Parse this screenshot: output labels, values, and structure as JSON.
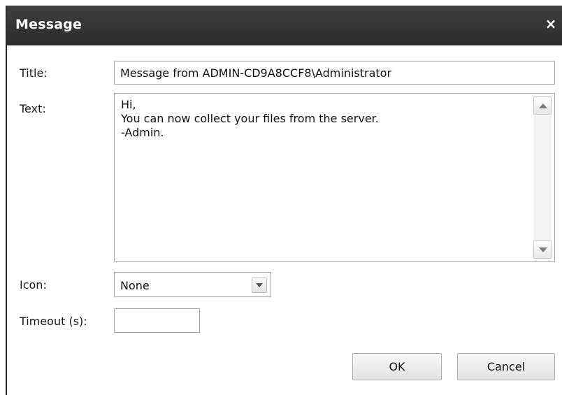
{
  "dialog": {
    "title": "Message",
    "close_glyph": "×"
  },
  "form": {
    "title_label": "Title:",
    "title_value": "Message from ADMIN-CD9A8CCF8\\Administrator",
    "text_label": "Text:",
    "text_lines": [
      "Hi,",
      "You can now collect your files from the server.",
      "-Admin."
    ],
    "icon_label": "Icon:",
    "icon_value": "None",
    "timeout_label": "Timeout (s):",
    "timeout_value": ""
  },
  "buttons": {
    "ok_label": "OK",
    "cancel_label": "Cancel"
  },
  "icons": {
    "close": "close-icon",
    "scroll_up": "arrow-up-icon",
    "scroll_down": "arrow-down-icon",
    "dropdown": "chevron-down-icon"
  },
  "colors": {
    "titlebar": "#333333",
    "titlebar_text": "#ffffff",
    "border": "#a9a9a9"
  }
}
